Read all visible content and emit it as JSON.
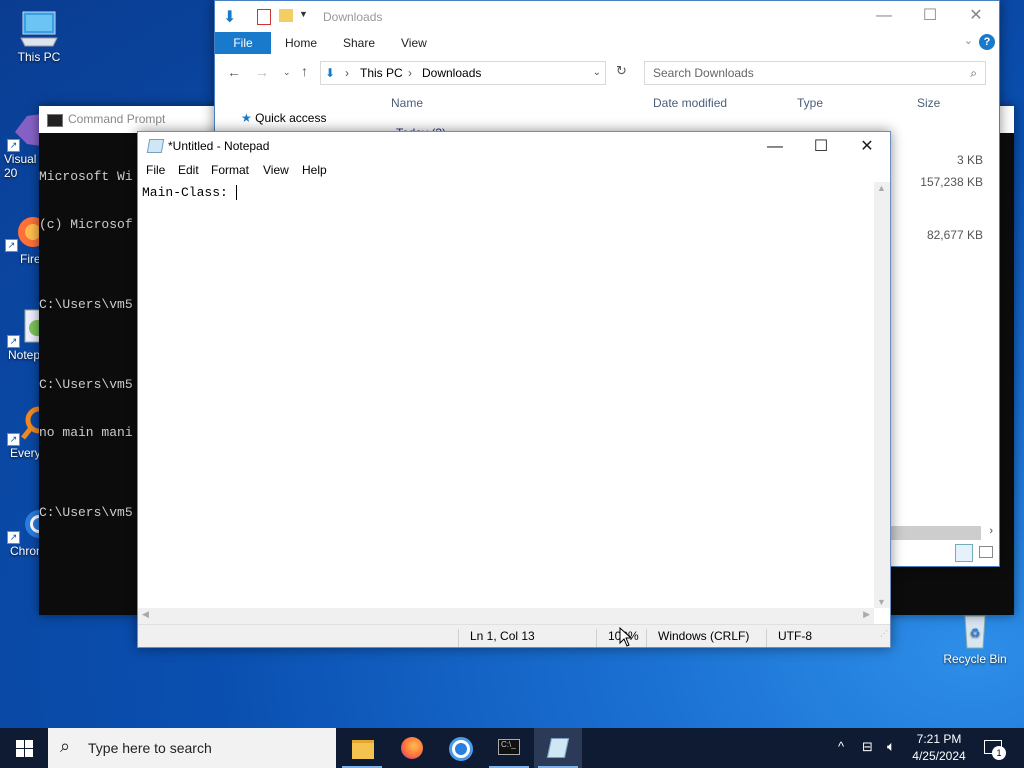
{
  "desktop": {
    "icons": [
      {
        "label": "This PC"
      },
      {
        "label": "Visual\n20"
      },
      {
        "label": "Fire"
      },
      {
        "label": "Notep"
      },
      {
        "label": "Every"
      },
      {
        "label": "Chron"
      },
      {
        "label": "Recycle Bin"
      }
    ]
  },
  "explorer": {
    "title": "Downloads",
    "ribbon": {
      "file": "File",
      "home": "Home",
      "share": "Share",
      "view": "View"
    },
    "breadcrumb": [
      "This PC",
      "Downloads"
    ],
    "search_placeholder": "Search Downloads",
    "nav": {
      "quick_access": "Quick access"
    },
    "columns": {
      "name": "Name",
      "date": "Date modified",
      "type": "Type",
      "size": "Size"
    },
    "partial_group": "Today (3)",
    "sizes": [
      "3 KB",
      "157,238 KB",
      "82,677 KB"
    ]
  },
  "cmd": {
    "title": "Command Prompt",
    "lines": [
      "Microsoft Wi",
      "(c) Microsof",
      "",
      "C:\\Users\\vm5",
      "",
      "C:\\Users\\vm5",
      "no main mani",
      "",
      "C:\\Users\\vm5"
    ]
  },
  "notepad": {
    "title": "*Untitled - Notepad",
    "menu": {
      "file": "File",
      "edit": "Edit",
      "format": "Format",
      "view": "View",
      "help": "Help"
    },
    "content": "Main-Class: ",
    "status": {
      "position": "Ln 1, Col 13",
      "zoom": "100%",
      "line_ending": "Windows (CRLF)",
      "encoding": "UTF-8"
    }
  },
  "taskbar": {
    "search_placeholder": "Type here to search",
    "time": "7:21 PM",
    "date": "4/25/2024",
    "notification_count": "1"
  }
}
